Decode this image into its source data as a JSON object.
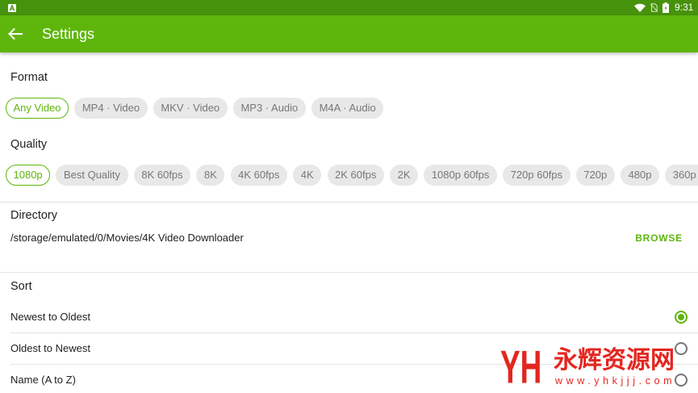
{
  "theme": {
    "accent": "#5eb60c",
    "app_bar": "#5eb60c",
    "status_bar": "#47920c",
    "chip_bg": "#e8e8e8",
    "chip_text": "#777777",
    "text_primary": "#212121",
    "divider": "#e4e4e4",
    "radio_off": "#757575",
    "watermark": "#e3261f"
  },
  "status_bar": {
    "left_icons": [
      "a-notification-icon"
    ],
    "right_icons": [
      "wifi-icon",
      "no-sim-icon",
      "battery-icon"
    ],
    "time": "9:31"
  },
  "app_bar": {
    "nav_icon": "back-arrow-icon",
    "title": "Settings"
  },
  "format": {
    "label": "Format",
    "chips": [
      {
        "label": "Any Video",
        "selected": true
      },
      {
        "label": "MP4 · Video",
        "selected": false
      },
      {
        "label": "MKV · Video",
        "selected": false
      },
      {
        "label": "MP3 · Audio",
        "selected": false
      },
      {
        "label": "M4A · Audio",
        "selected": false
      }
    ]
  },
  "quality": {
    "label": "Quality",
    "chips": [
      {
        "label": "1080p",
        "selected": true
      },
      {
        "label": "Best Quality",
        "selected": false
      },
      {
        "label": "8K 60fps",
        "selected": false
      },
      {
        "label": "8K",
        "selected": false
      },
      {
        "label": "4K 60fps",
        "selected": false
      },
      {
        "label": "4K",
        "selected": false
      },
      {
        "label": "2K 60fps",
        "selected": false
      },
      {
        "label": "2K",
        "selected": false
      },
      {
        "label": "1080p 60fps",
        "selected": false
      },
      {
        "label": "720p 60fps",
        "selected": false
      },
      {
        "label": "720p",
        "selected": false
      },
      {
        "label": "480p",
        "selected": false
      },
      {
        "label": "360p",
        "selected": false
      }
    ]
  },
  "directory": {
    "label": "Directory",
    "path": "/storage/emulated/0/Movies/4K Video Downloader",
    "browse_label": "BROWSE"
  },
  "sort": {
    "label": "Sort",
    "options": [
      {
        "label": "Newest to Oldest",
        "selected": true
      },
      {
        "label": "Oldest to Newest",
        "selected": false
      },
      {
        "label": "Name (A to Z)",
        "selected": false
      }
    ]
  },
  "watermark": {
    "logo_text": "YH",
    "name": "永辉资源网",
    "url": "www.yhkjjj.com"
  }
}
